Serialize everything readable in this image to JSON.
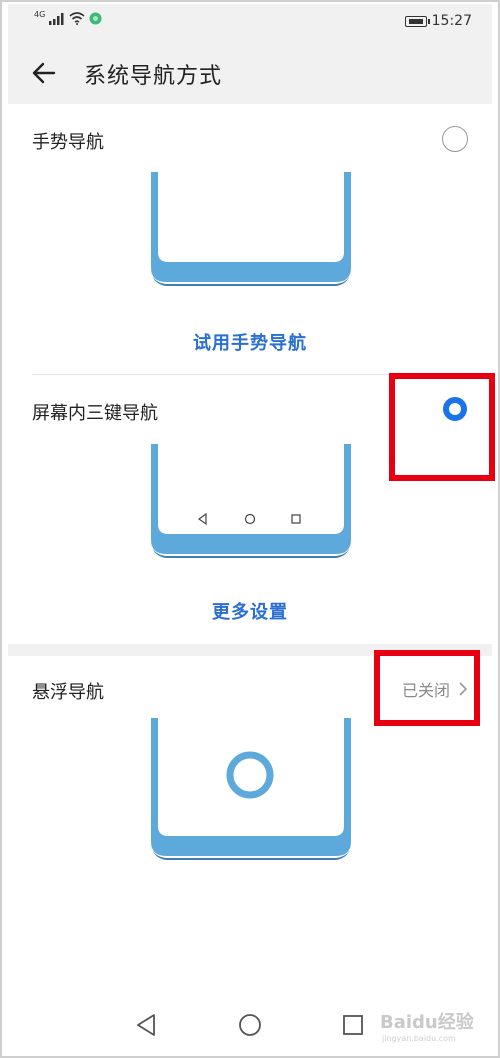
{
  "status_bar": {
    "network": "4G",
    "time": "15:27"
  },
  "header": {
    "title": "系统导航方式",
    "back_icon": "arrow-left-icon"
  },
  "options": [
    {
      "label": "手势导航",
      "selected": false,
      "action_label": "试用手势导航"
    },
    {
      "label": "屏幕内三键导航",
      "selected": true,
      "action_label": "更多设置",
      "nav_icons": [
        "triangle-back-icon",
        "circle-home-icon",
        "square-recent-icon"
      ]
    },
    {
      "label": "悬浮导航",
      "status": "已关闭",
      "status_icon": "chevron-right-icon"
    }
  ],
  "navbar": {
    "icons": [
      "back-triangle-icon",
      "home-circle-icon",
      "recents-square-icon"
    ]
  },
  "watermark": {
    "text": "Baidu经验",
    "sub": "jingyan.baidu.com"
  },
  "colors": {
    "accent": "#1a73e8",
    "link": "#2a6fd1",
    "illustration": "#5ea9dc",
    "illustration_dark": "#3d7fb5",
    "highlight": "#e60012"
  }
}
